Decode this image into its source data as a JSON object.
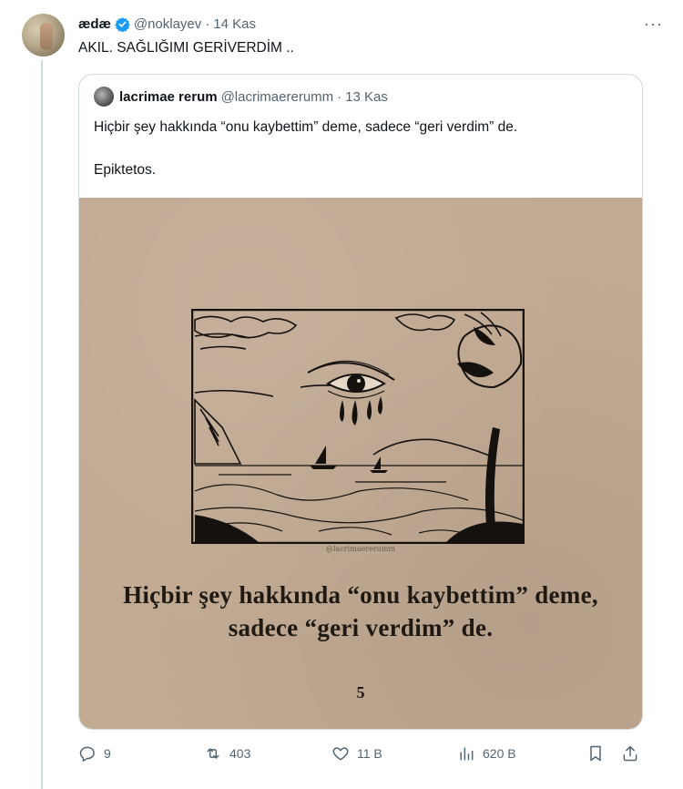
{
  "tweet": {
    "display_name": "ædæ",
    "handle": "@noklayev",
    "separator": "·",
    "date": "14 Kas",
    "more": "···",
    "text": "AKIL. SAĞLIĞIMI GERİVERDİM .."
  },
  "quote": {
    "display_name": "lacrimae rerum",
    "handle": "@lacrimaererumm",
    "separator": "·",
    "date": "13 Kas",
    "text_line1": "Hiçbir şey hakkında “onu kaybettim” deme, sadece “geri verdim” de.",
    "text_line2": "Epiktetos.",
    "image": {
      "credit": "@lacrimaererumm",
      "caption_line1": "Hiçbir şey hakkında “onu kaybettim” deme,",
      "caption_line2": "sadece “geri verdim” de.",
      "page_number": "5"
    }
  },
  "actions": {
    "replies": "9",
    "retweets": "403",
    "likes": "11 B",
    "views": "620 B"
  },
  "colors": {
    "text": "#0f1419",
    "muted": "#536471",
    "border": "#cfd9de",
    "verified": "#1d9bf0",
    "paper": "#c1a992"
  }
}
